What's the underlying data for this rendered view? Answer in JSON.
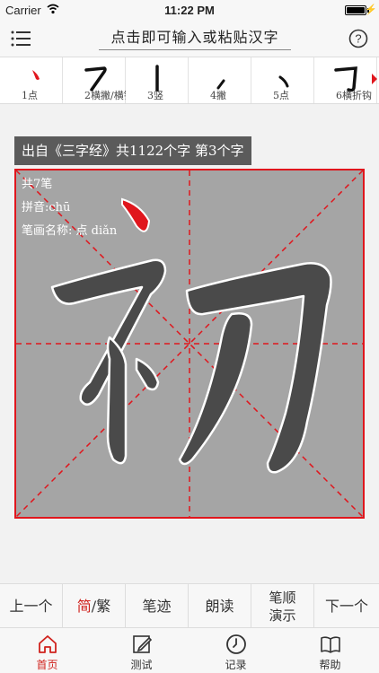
{
  "status": {
    "carrier": "Carrier",
    "time": "11:22 PM"
  },
  "header": {
    "search_placeholder": "点击即可输入或粘贴汉字"
  },
  "strokes": [
    {
      "label": "1点"
    },
    {
      "label": "2横撇/横钩"
    },
    {
      "label": "3竖"
    },
    {
      "label": "4撇"
    },
    {
      "label": "5点"
    },
    {
      "label": "6横折钩"
    }
  ],
  "main": {
    "source": "出自《三字经》共1122个字 第3个字",
    "stroke_count": "共7笔",
    "pinyin": "拼音:chū",
    "stroke_name": "笔画名称: 点 diǎn",
    "character": "初"
  },
  "toolbar": {
    "prev": "上一个",
    "simplified": "简",
    "separator": "/",
    "traditional": "繁",
    "trace": "笔迹",
    "read": "朗读",
    "order_line1": "笔顺",
    "order_line2": "演示",
    "next": "下一个"
  },
  "tabs": [
    {
      "label": "首页"
    },
    {
      "label": "测试"
    },
    {
      "label": "记录"
    },
    {
      "label": "帮助"
    }
  ],
  "colors": {
    "accent": "#d0221d",
    "grid_bg": "#a5a5a5",
    "source_bg": "#5b5b5b"
  }
}
